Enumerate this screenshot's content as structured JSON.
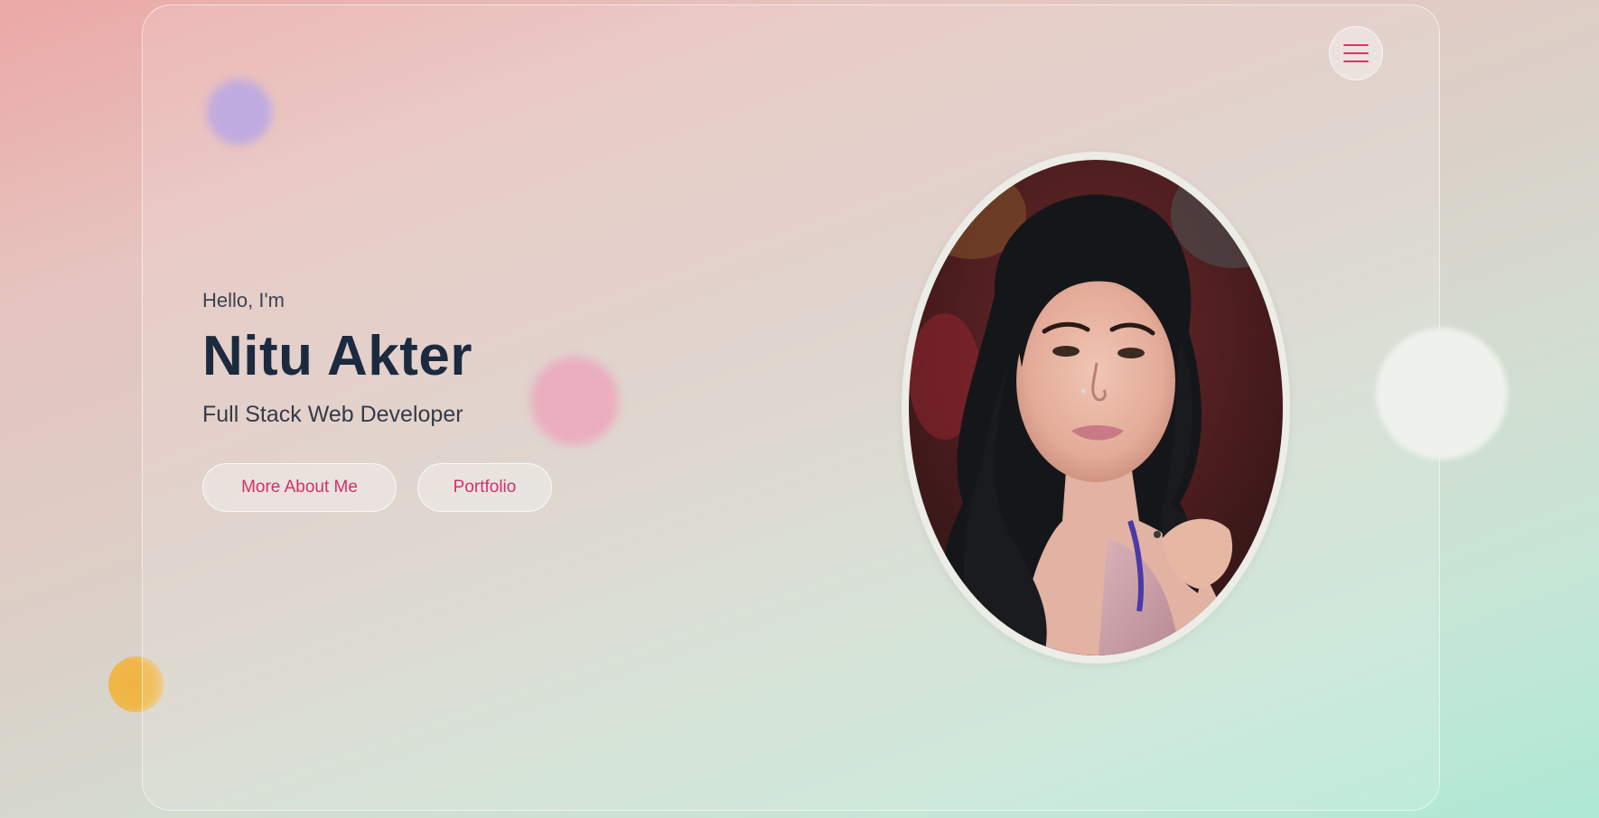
{
  "hero": {
    "greeting": "Hello, I'm",
    "name": "Nitu Akter",
    "role": "Full Stack Web Developer"
  },
  "buttons": {
    "about_label": "More About Me",
    "portfolio_label": "Portfolio"
  },
  "nav": {
    "menu_icon": "hamburger-menu-icon"
  },
  "colors": {
    "accent": "#d6346c",
    "heading": "#1c2a40",
    "body_text": "#353b48"
  }
}
